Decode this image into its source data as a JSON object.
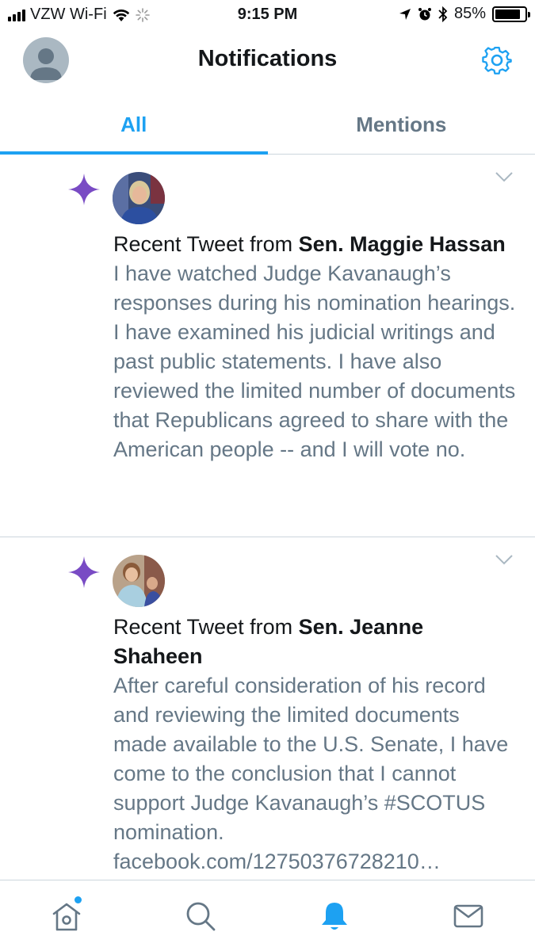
{
  "status_bar": {
    "carrier": "VZW Wi-Fi",
    "time": "9:15 PM",
    "battery": "85%",
    "battery_level": 0.85,
    "icons": [
      "signal-icon",
      "wifi-icon",
      "loading-icon",
      "location-icon",
      "alarm-icon",
      "bluetooth-icon",
      "battery-icon"
    ]
  },
  "header": {
    "title": "Notifications",
    "left_icon": "profile-avatar",
    "right_icon": "gear-icon"
  },
  "tabs": [
    {
      "label": "All",
      "active": true
    },
    {
      "label": "Mentions",
      "active": false
    }
  ],
  "notifications": [
    {
      "icon": "sparkle-icon",
      "prefix": "Recent Tweet from ",
      "author": "Sen. Maggie Hassan",
      "text": "I have watched Judge Kavanaugh’s responses during his nomination hearings. I have examined his judicial writings and past public statements. I have also reviewed the limited number of documents that Republicans agreed to share with the American people -- and I will vote no."
    },
    {
      "icon": "sparkle-icon",
      "prefix": "Recent Tweet from ",
      "author": "Sen. Jeanne Shaheen",
      "text": "After careful consideration of his record and reviewing the limited documents made available to the U.S. Senate, I have come to the conclusion that I cannot support Judge Kavanaugh’s #SCOTUS nomination. facebook.com/12750376728210…"
    }
  ],
  "bottom_nav": [
    {
      "icon": "home-icon",
      "active": false,
      "badge": true
    },
    {
      "icon": "search-icon",
      "active": false
    },
    {
      "icon": "bell-icon",
      "active": true
    },
    {
      "icon": "mail-icon",
      "active": false
    }
  ],
  "colors": {
    "accent": "#1da1f2",
    "sparkle": "#794bc4",
    "secondary_text": "#657786",
    "divider": "#ccd6dd"
  }
}
